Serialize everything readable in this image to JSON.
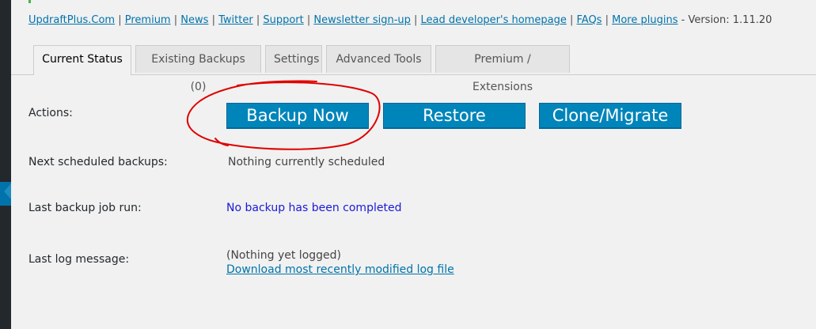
{
  "header_links": {
    "items": [
      "UpdraftPlus.Com",
      "Premium",
      "News",
      "Twitter",
      "Support",
      "Newsletter sign-up",
      "Lead developer's homepage",
      "FAQs",
      "More plugins"
    ],
    "version_text": "- Version: 1.11.20"
  },
  "tabs": [
    {
      "label": "Current Status",
      "active": true
    },
    {
      "label": "Existing Backups (0)",
      "active": false
    },
    {
      "label": "Settings",
      "active": false
    },
    {
      "label": "Advanced Tools",
      "active": false
    },
    {
      "label": "Premium / Extensions",
      "active": false
    }
  ],
  "actions": {
    "label": "Actions:",
    "backup_now": "Backup Now",
    "restore": "Restore",
    "clone_migrate": "Clone/Migrate"
  },
  "next_scheduled": {
    "label": "Next scheduled backups:",
    "value": "Nothing currently scheduled"
  },
  "last_backup": {
    "label": "Last backup job run:",
    "value": "No backup has been completed"
  },
  "last_log": {
    "label": "Last log message:",
    "value": "(Nothing yet logged)",
    "download_link": "Download most recently modified log file"
  },
  "colors": {
    "button_blue": "#0085ba",
    "link_blue": "#0073aa",
    "annotation_red": "#e00000"
  }
}
